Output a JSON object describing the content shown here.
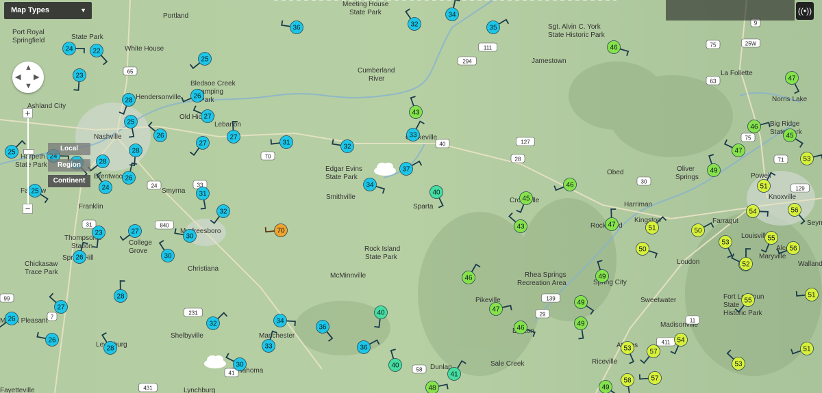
{
  "controls": {
    "map_types_label": "Map Types",
    "scale_local": "Local",
    "scale_region": "Region",
    "scale_continent": "Continent",
    "zoom_in": "+",
    "zoom_out": "−",
    "pan_up": "▲",
    "pan_down": "▼",
    "pan_left": "◀",
    "pan_right": "▶",
    "broadcast_icon": "((•))"
  },
  "places": [
    "Portland",
    "Meeting House",
    "State Park",
    "Port Royal",
    "State Park",
    "Springfield",
    "White House",
    "Sgt. Alvin C. York",
    "State Historic Park",
    "Jamestown",
    "La Follette",
    "Norris Lake",
    "Big Ridge",
    "State Park",
    "Cumberland",
    "River",
    "Bledsoe Creek",
    "Camping",
    "Park",
    "Hendersonville",
    "Ashland City",
    "Nashville",
    "Old Hickory",
    "Lebanon",
    "Cookeville",
    "Edgar Evins",
    "State Park",
    "Smithville",
    "Sparta",
    "Crossville",
    "Oliver",
    "Springs",
    "Powell",
    "Knoxville",
    "Harriman",
    "Kingston",
    "Rockwood",
    "Farragut",
    "Louisville",
    "Maryville",
    "Seymour",
    "Alcoa",
    "Walland",
    "Loudon",
    "Franklin",
    "Smyrna",
    "Brentwood",
    "Murfreesboro",
    "College",
    "Grove",
    "Thompson's",
    "Station",
    "Spring Hill",
    "Christiana",
    "McMinnville",
    "Rock Island",
    "State Park",
    "Pikeville",
    "Rhea Springs",
    "Recreation Area",
    "Spring City",
    "Sweetwater",
    "Chickasaw",
    "Trace Park",
    "Mount Pleasant",
    "Shelbyville",
    "Manchester",
    "Tullahoma",
    "Lewisburg",
    "Dunlap",
    "Sale Creek",
    "Dayton",
    "Riceville",
    "Athens",
    "Madisonville",
    "Fort Loudoun",
    "State",
    "Historic Park",
    "Obed",
    "Fayetteville",
    "Lynchburg",
    "Harpeth",
    "State Park",
    "Fairview"
  ],
  "routes": [
    "65",
    "294",
    "111",
    "127",
    "28",
    "70",
    "40",
    "24",
    "840",
    "31",
    "231",
    "41",
    "431",
    "75",
    "75",
    "25W",
    "63",
    "71",
    "411",
    "9",
    "129",
    "29",
    "58",
    "11",
    "30",
    "99",
    "7",
    "139",
    "33"
  ],
  "stations": [
    24,
    22,
    23,
    25,
    36,
    32,
    34,
    35,
    46,
    47,
    28,
    26,
    27,
    43,
    33,
    46,
    45,
    25,
    27,
    31,
    26,
    27,
    25,
    24,
    26,
    28,
    28,
    32,
    24,
    26,
    37,
    34,
    40,
    45,
    46,
    47,
    49,
    51,
    53,
    25,
    31,
    32,
    70,
    43,
    47,
    51,
    54,
    56,
    23,
    27,
    30,
    30,
    26,
    50,
    50,
    53,
    55,
    56,
    52,
    49,
    46,
    47,
    49,
    49,
    55,
    51,
    27,
    28,
    32,
    34,
    36,
    40,
    26,
    26,
    28,
    33,
    36,
    46,
    53,
    54,
    51,
    30,
    40,
    41,
    48,
    49,
    58,
    57,
    57,
    53,
    52
  ],
  "accent": {
    "cool": "#1cc6e8",
    "mild": "#86e24a",
    "warm": "#d9f03a",
    "hot": "#f0a32d"
  }
}
